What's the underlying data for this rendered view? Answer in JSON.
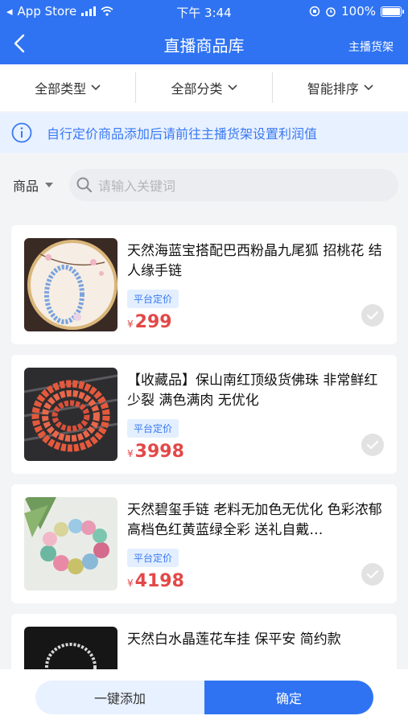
{
  "status_bar": {
    "carrier": "App Store",
    "time": "下午 3:44",
    "battery": "100%"
  },
  "nav": {
    "title": "直播商品库",
    "right_link": "主播货架"
  },
  "filters": [
    {
      "label": "全部类型"
    },
    {
      "label": "全部分类"
    },
    {
      "label": "智能排序"
    }
  ],
  "notice": {
    "text": "自行定价商品添加后请前往主播货架设置利润值"
  },
  "search": {
    "type_label": "商品",
    "placeholder": "请输入关键词"
  },
  "products": [
    {
      "title": "天然海蓝宝搭配巴西粉晶九尾狐 招桃花 结人缘手链",
      "tag": "平台定价",
      "currency": "¥",
      "price": "299"
    },
    {
      "title": "【收藏品】保山南红顶级货佛珠 非常鲜红 少裂 满色满肉 无优化",
      "tag": "平台定价",
      "currency": "¥",
      "price": "3998"
    },
    {
      "title": "天然碧玺手链 老料无加色无优化 色彩浓郁 高档色红黄蓝绿全彩 送礼自戴…",
      "tag": "平台定价",
      "currency": "¥",
      "price": "4198"
    },
    {
      "title": "天然白水晶莲花车挂 保平安 简约款"
    }
  ],
  "bottom": {
    "add_all_label": "一键添加",
    "confirm_label": "确定"
  },
  "colors": {
    "primary": "#2f73f2",
    "price": "#e34848",
    "notice_bg": "#e8f1ff",
    "tag_bg": "#e3efff"
  }
}
